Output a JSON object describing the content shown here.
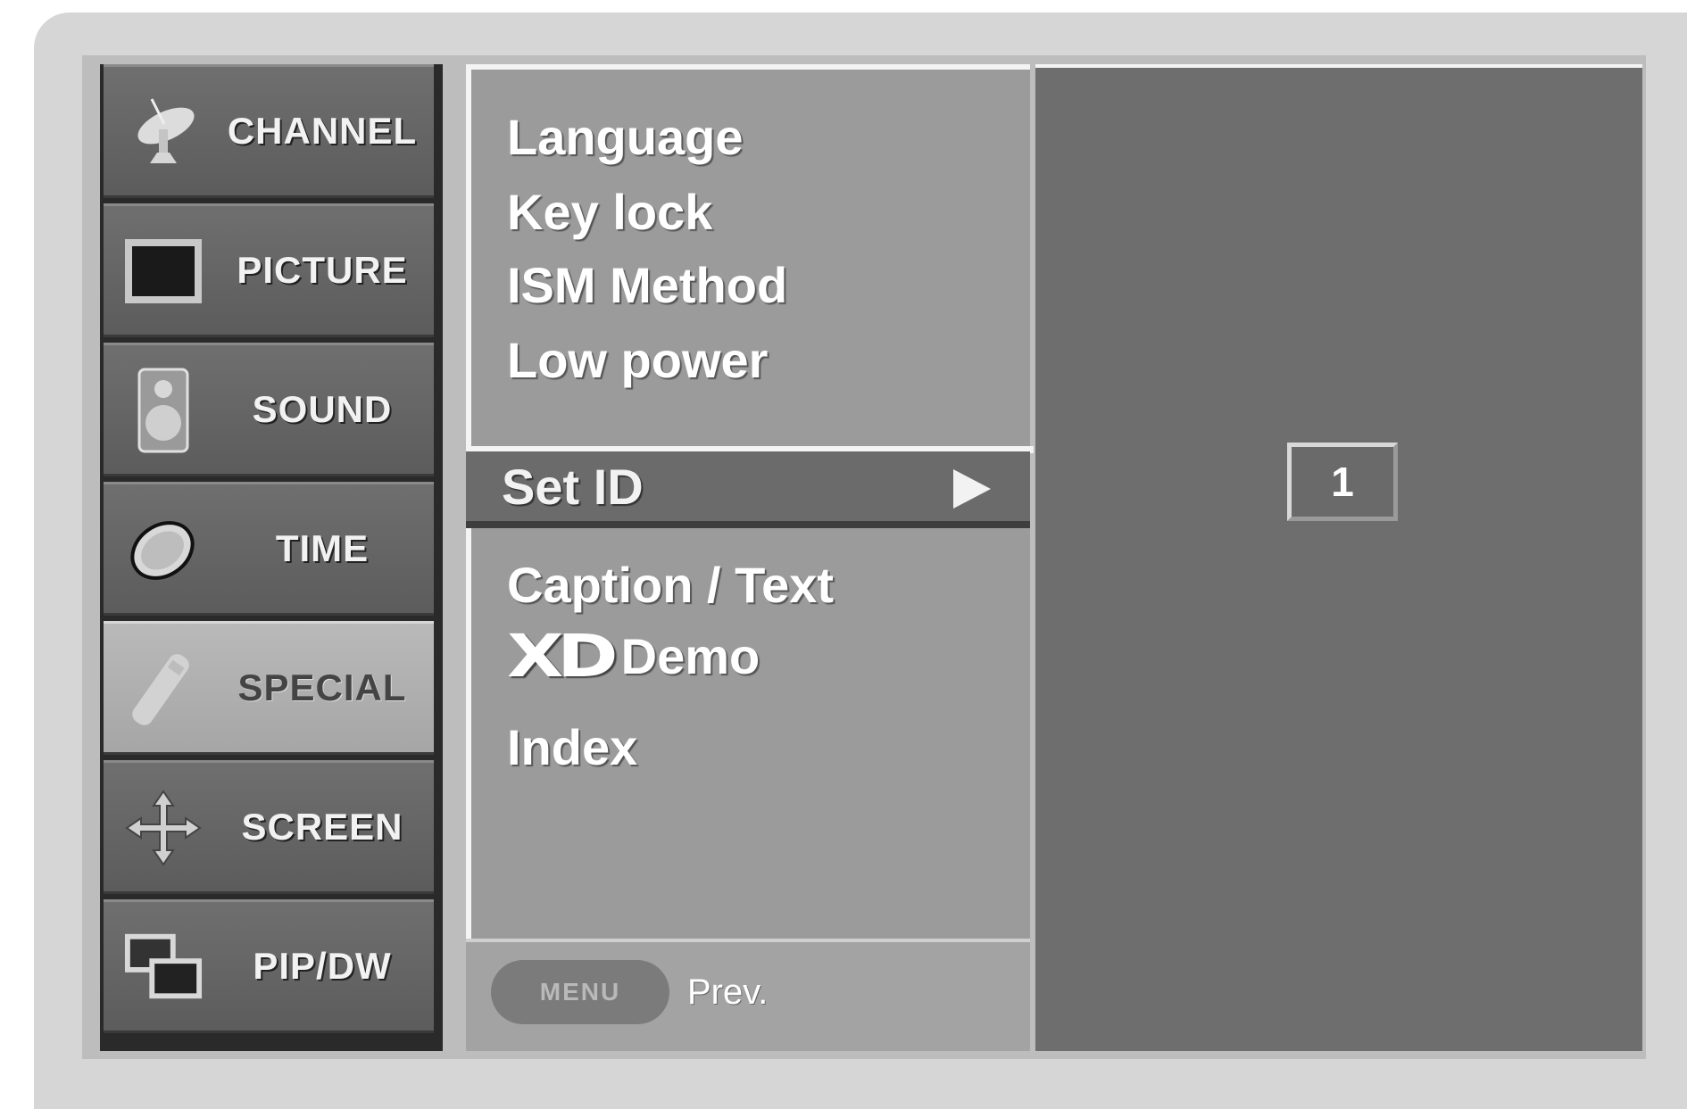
{
  "categories": [
    {
      "label": "CHANNEL",
      "icon": "satellite-dish-icon"
    },
    {
      "label": "PICTURE",
      "icon": "tv-screen-icon"
    },
    {
      "label": "SOUND",
      "icon": "speaker-icon"
    },
    {
      "label": "TIME",
      "icon": "clock-icon"
    },
    {
      "label": "SPECIAL",
      "icon": "remote-control-icon",
      "active": true
    },
    {
      "label": "SCREEN",
      "icon": "move-arrows-icon"
    },
    {
      "label": "PIP/DW",
      "icon": "pip-windows-icon"
    }
  ],
  "submenu": {
    "items": [
      "Language",
      "Key lock",
      "ISM Method",
      "Low power"
    ],
    "selected": "Set ID",
    "items_after": [
      "Caption / Text"
    ],
    "xd_logo": "XD",
    "xd_demo": "Demo",
    "index": "Index"
  },
  "footer": {
    "menu_button": "MENU",
    "prev_label": "Prev."
  },
  "value_panel": {
    "set_id_value": "1"
  }
}
